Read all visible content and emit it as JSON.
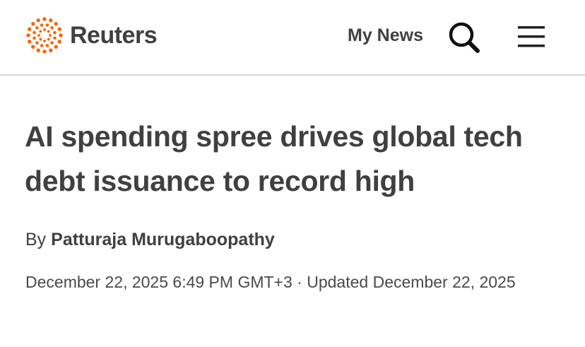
{
  "header": {
    "brand_name": "Reuters",
    "brand_color": "#fa6400",
    "my_news_label": "My News",
    "search_icon": "search-icon",
    "menu_icon": "hamburger-menu-icon"
  },
  "article": {
    "headline": "AI spending spree drives global tech debt issuance to record high",
    "byline_prefix": "By",
    "author": "Patturaja Murugaboopathy",
    "published": "December 22, 2025 6:49 PM GMT+3",
    "separator": "·",
    "updated_prefix": "Updated",
    "updated": "December 22, 2025"
  }
}
